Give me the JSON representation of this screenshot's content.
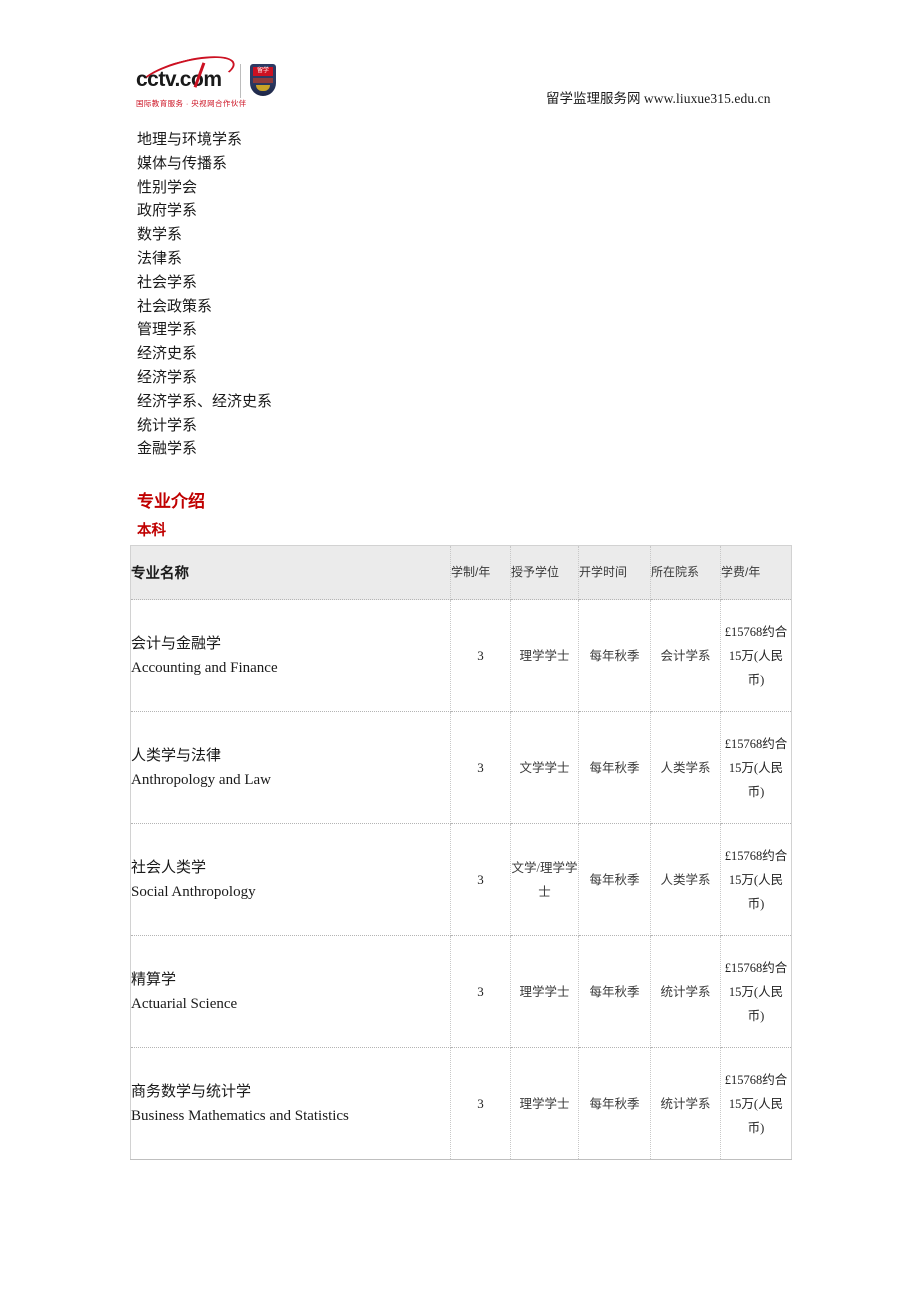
{
  "header": {
    "logo": {
      "wordmark": "cctv.com",
      "shield_label": "留学",
      "tagline": "国际教育服务 · 央视网合作伙伴"
    },
    "site_name": "留学监理服务网",
    "site_url": "www.liuxue315.edu.cn"
  },
  "departments": [
    "地理与环境学系",
    "媒体与传播系",
    "性别学会",
    "政府学系",
    "数学系",
    "法律系",
    "社会学系",
    "社会政策系",
    "管理学系",
    "经济史系",
    "经济学系",
    "经济学系、经济史系",
    "统计学系",
    "金融学系"
  ],
  "sections": {
    "major_intro_title": "专业介绍",
    "level_title": "本科"
  },
  "table": {
    "headers": {
      "name": "专业名称",
      "years": "学制/年",
      "degree": "授予学位",
      "start": "开学时间",
      "department": "所在院系",
      "tuition": "学费/年"
    },
    "rows": [
      {
        "name_cn": "会计与金融学",
        "name_en": "Accounting and Finance",
        "years": "3",
        "degree": "理学学士",
        "start": "每年秋季",
        "department": "会计学系",
        "tuition": "£15768约合 15万(人民币)"
      },
      {
        "name_cn": "人类学与法律",
        "name_en": "Anthropology and Law",
        "years": "3",
        "degree": "文学学士",
        "start": "每年秋季",
        "department": "人类学系",
        "tuition": "£15768约合 15万(人民币)"
      },
      {
        "name_cn": "社会人类学",
        "name_en": "Social Anthropology",
        "years": "3",
        "degree": "文学/理学学士",
        "start": "每年秋季",
        "department": "人类学系",
        "tuition": "£15768约合 15万(人民币)"
      },
      {
        "name_cn": "精算学",
        "name_en": "Actuarial Science",
        "years": "3",
        "degree": "理学学士",
        "start": "每年秋季",
        "department": "统计学系",
        "tuition": "£15768约合 15万(人民币)"
      },
      {
        "name_cn": "商务数学与统计学",
        "name_en": "Business Mathematics and Statistics",
        "years": "3",
        "degree": "理学学士",
        "start": "每年秋季",
        "department": "统计学系",
        "tuition": "£15768约合 15万(人民币)"
      }
    ]
  },
  "colors": {
    "accent_red": "#c00000",
    "logo_red": "#cc1122",
    "header_bg": "#ebebeb"
  }
}
